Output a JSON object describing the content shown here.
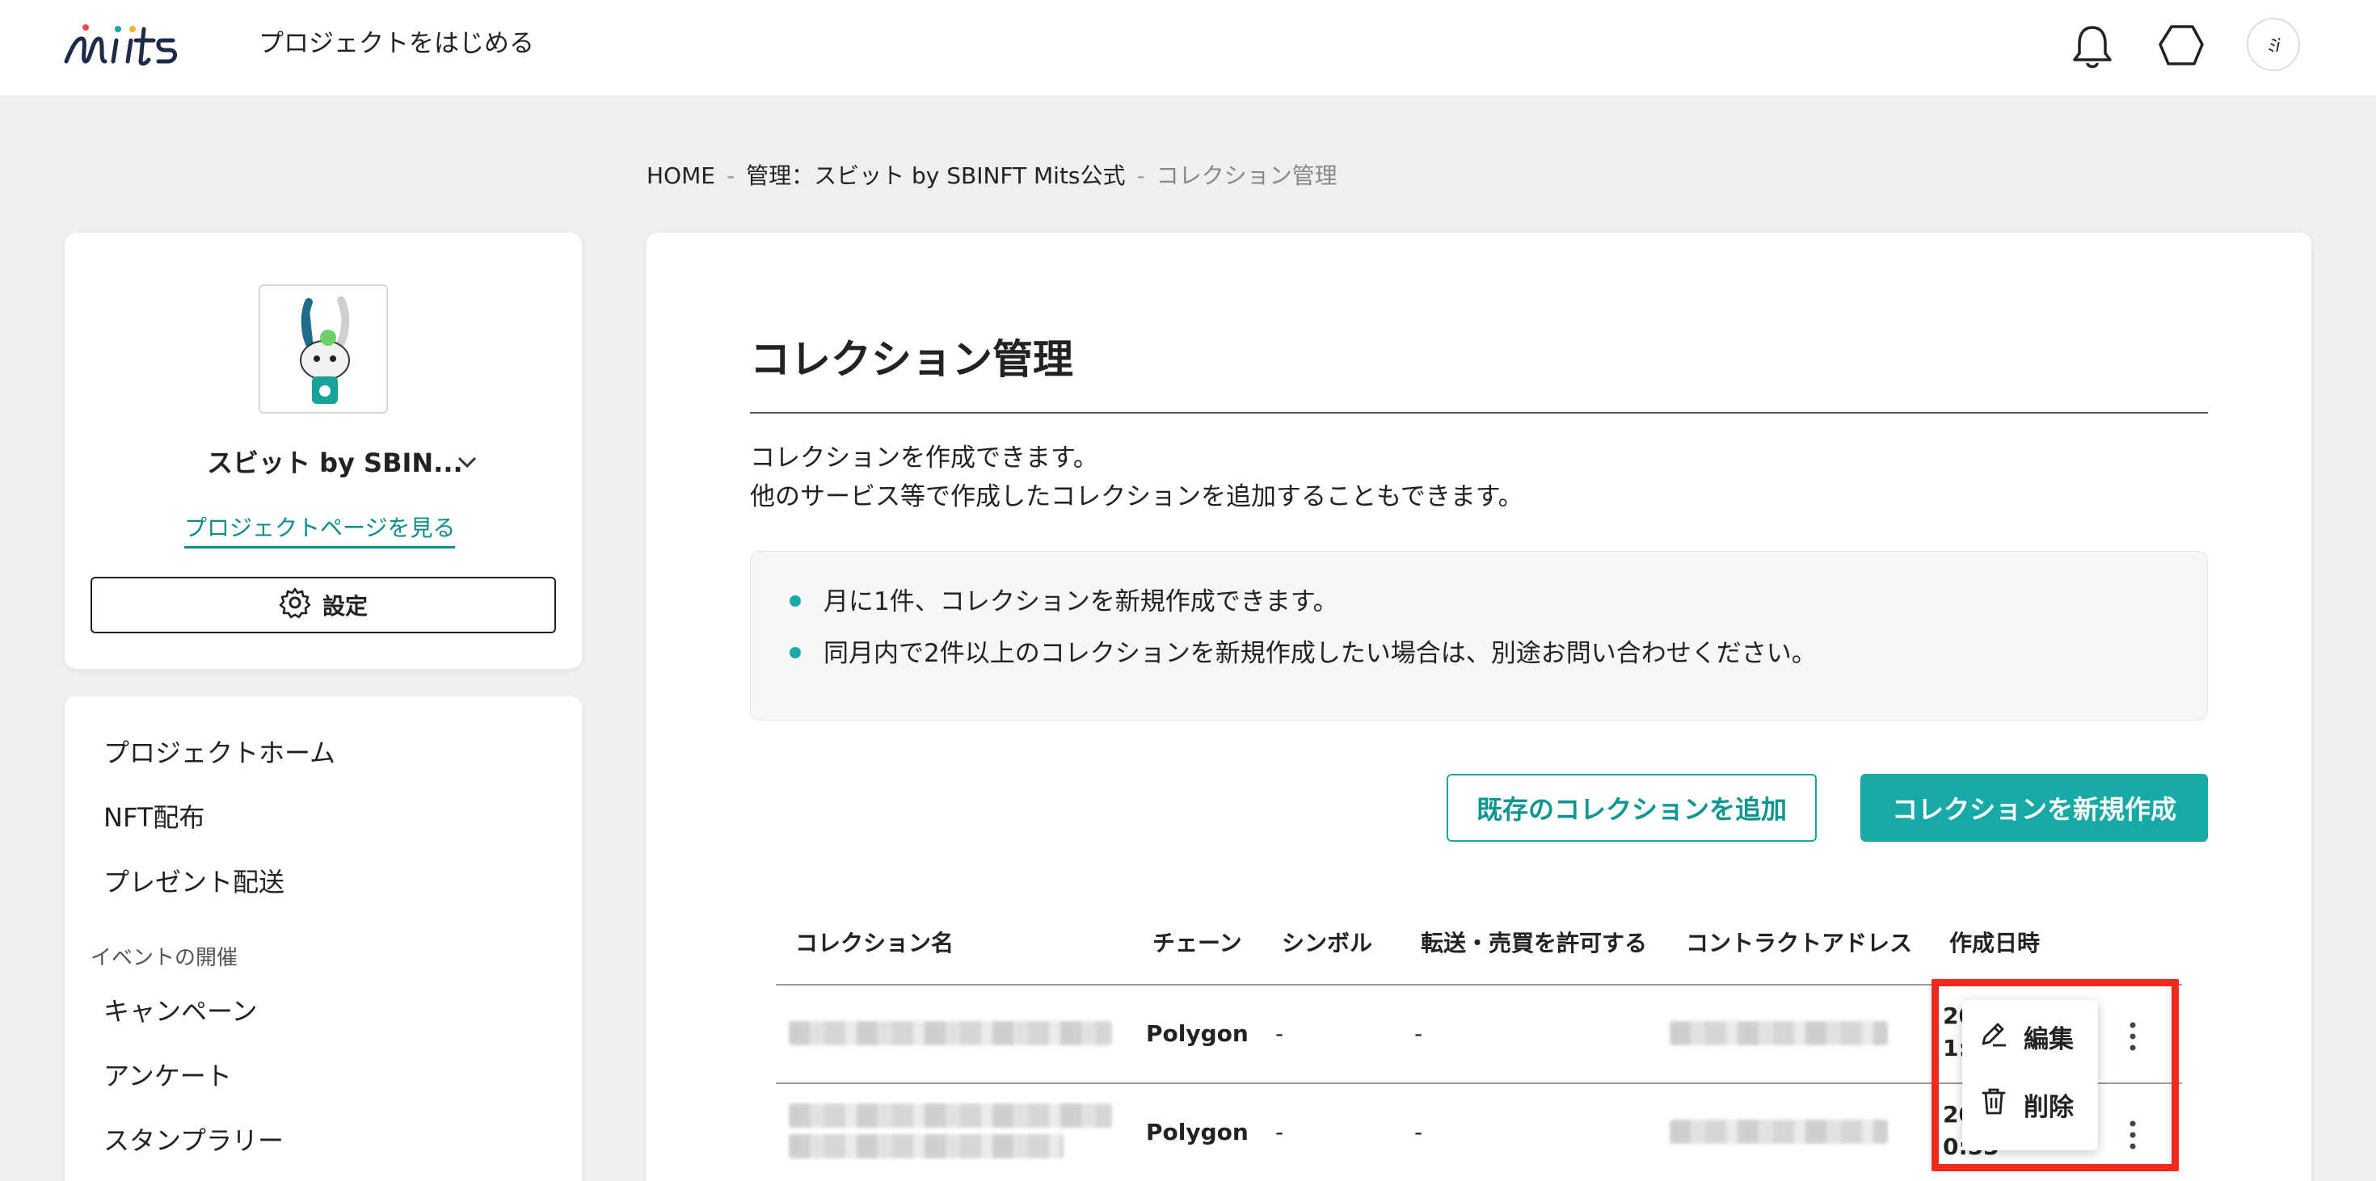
{
  "header": {
    "start_project_label": "プロジェクトをはじめる",
    "avatar_text": "ﾐi"
  },
  "breadcrumb": {
    "home": "HOME",
    "separator": "-",
    "manage": "管理：スビット by SBINFT Mits公式",
    "current": "コレクション管理"
  },
  "project": {
    "name": "スビット by SBIN...",
    "page_link": "プロジェクトページを見る",
    "settings_label": "設定"
  },
  "sidebar": {
    "items": [
      {
        "label": "プロジェクトホーム"
      },
      {
        "label": "NFT配布"
      },
      {
        "label": "プレゼント配送"
      }
    ],
    "section_label": "イベントの開催",
    "event_items": [
      {
        "label": "キャンペーン"
      },
      {
        "label": "アンケート"
      },
      {
        "label": "スタンプラリー"
      }
    ]
  },
  "main": {
    "title": "コレクション管理",
    "description": [
      "コレクションを作成できます。",
      "他のサービス等で作成したコレクションを追加することもできます。"
    ],
    "notices": [
      "月に1件、コレクションを新規作成できます。",
      "同月内で2件以上のコレクションを新規作成したい場合は、別途お問い合わせください。"
    ],
    "add_existing_label": "既存のコレクションを追加",
    "create_new_label": "コレクションを新規作成"
  },
  "table": {
    "headers": [
      "コレクション名",
      "チェーン",
      "シンボル",
      "転送・売買を許可する",
      "コントラクトアドレス",
      "作成日時"
    ],
    "rows": [
      {
        "chain": "Polygon",
        "symbol": "-",
        "transfer": "-",
        "date_line1": "20",
        "date_line2": "1:"
      },
      {
        "chain": "Polygon",
        "symbol": "-",
        "transfer": "-",
        "date_line1": "20",
        "date_line2": "0:53"
      }
    ]
  },
  "menu": {
    "edit_label": "編集",
    "delete_label": "削除"
  },
  "colors": {
    "accent": "#17a9a5",
    "highlight": "#ee2a1b"
  }
}
